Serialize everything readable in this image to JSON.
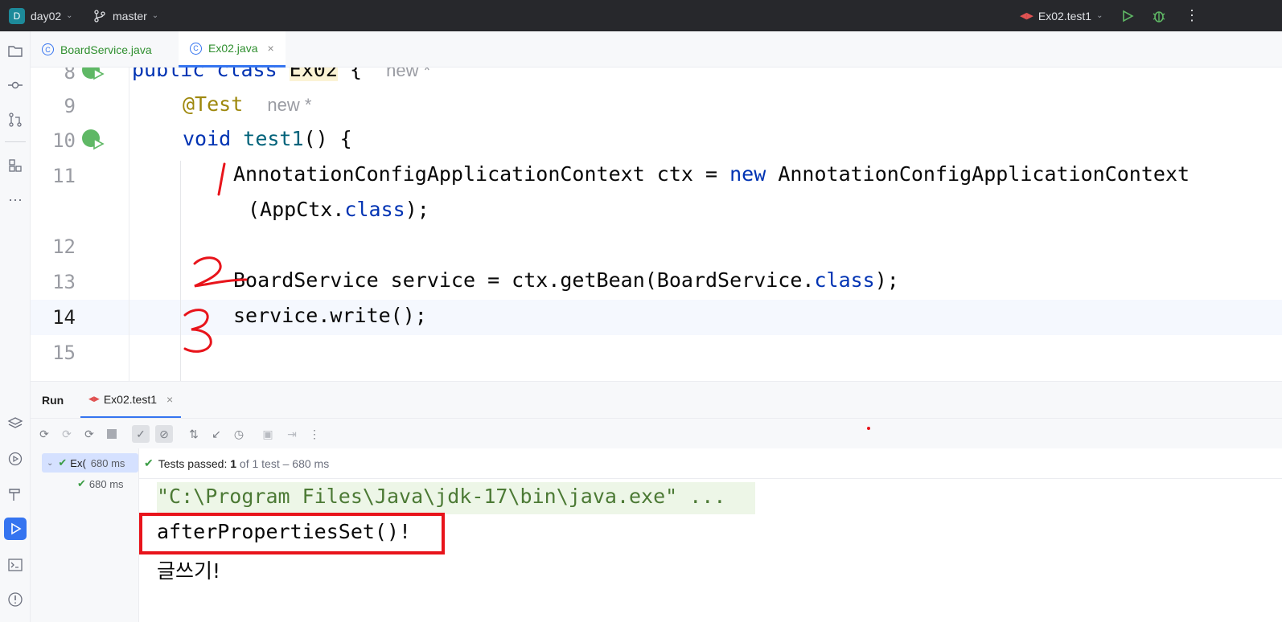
{
  "titlebar": {
    "project_initial": "D",
    "project": "day02",
    "branch": "master",
    "run_config": "Ex02.test1"
  },
  "tabs": [
    {
      "label": "BoardService.java",
      "icon": "class-icon",
      "active": false
    },
    {
      "label": "Ex02.java",
      "icon": "test-class-icon",
      "active": true
    }
  ],
  "editor": {
    "lines": [
      {
        "num": "8",
        "code_kw": "public class ",
        "code_rest": "Ex02",
        "brace": " {",
        "hint": "new *"
      },
      {
        "num": "9",
        "annotation": "@Test",
        "hint": "new *"
      },
      {
        "num": "10",
        "kw": "void ",
        "fn": "test1",
        "rest": "() {"
      },
      {
        "num": "11",
        "a": "AnnotationConfigApplicationContext ctx = ",
        "kw": "new",
        "b": " AnnotationConfigApplicationContext"
      },
      {
        "wrap": "(AppCtx.",
        "kw": "class",
        "end": ");"
      },
      {
        "num": "12"
      },
      {
        "num": "13",
        "a": "BoardService service = ctx.getBean(BoardService.",
        "kw": "class",
        "end": ");"
      },
      {
        "num": "14",
        "a": "service.write();"
      },
      {
        "num": "15"
      }
    ],
    "annotations": [
      "1",
      "2",
      "3"
    ]
  },
  "run_panel": {
    "title": "Run",
    "tab_label": "Ex02.test1",
    "status_prefix": "Tests passed:",
    "status_count": "1",
    "status_suffix": "of 1 test – 680 ms",
    "tree": [
      {
        "label": "Ex(",
        "time": "680 ms"
      },
      {
        "label": "",
        "time": "680 ms"
      }
    ],
    "console": [
      "\"C:\\Program Files\\Java\\jdk-17\\bin\\java.exe\" ...",
      "afterPropertiesSet()!",
      "글쓰기!"
    ]
  },
  "colors": {
    "accent": "#3574f0",
    "keyword": "#0033b3",
    "annotation": "#9e880d",
    "highlight_box": "#e8141b",
    "pass_green": "#3a9c44"
  }
}
